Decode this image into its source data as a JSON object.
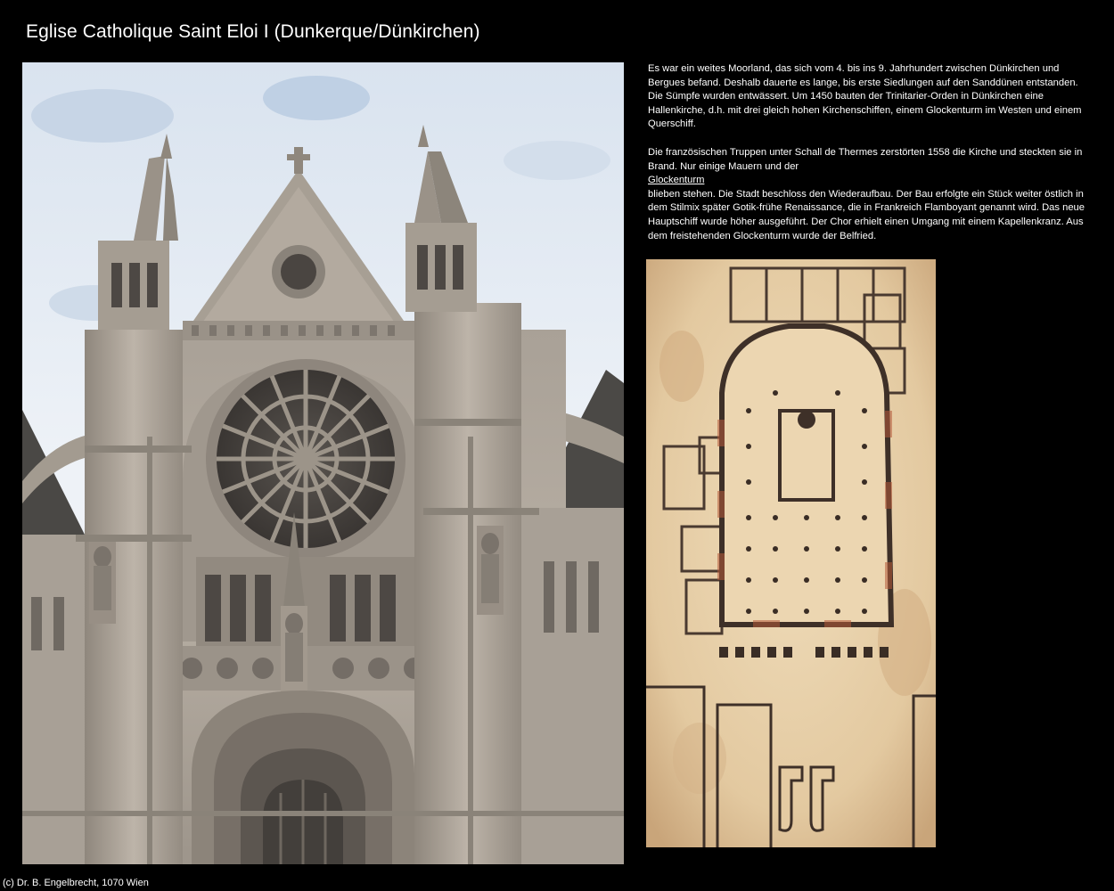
{
  "page": {
    "title": "Eglise Catholique Saint Eloi I (Dunkerque/Dünkirchen)",
    "copyright": "(c) Dr. B. Engelbrecht, 1070 Wien"
  },
  "description": {
    "paragraph1": "Es war ein weites Moorland, das sich vom 4. bis ins 9. Jahrhundert zwischen Dünkirchen und Bergues befand. Deshalb dauerte es lange, bis erste Siedlungen auf den Sanddünen entstanden. Die Sümpfe wurden entwässert. Um 1450 bauten der Trinitarier-Orden in Dünkirchen eine Hallenkirche, d.h. mit drei gleich hohen Kirchenschiffen, einem Glockenturm im Westen und einem Querschiff.",
    "paragraph2_before_link": "Die französischen Truppen unter Schall de Thermes zerstörten 1558 die Kirche und steckten sie in Brand. Nur einige Mauern und der",
    "link_text": "Glockenturm",
    "paragraph2_after_link": "blieben stehen. Die Stadt beschloss den Wiederaufbau. Der Bau erfolgte ein Stück weiter östlich in dem Stilmix später Gotik-frühe Renaissance, die in Frankreich Flamboyant genannt wird. Das neue Hauptschiff wurde höher ausgeführt. Der Chor erhielt einen Umgang mit einem Kapellenkranz. Aus dem freistehenden Glockenturm wurde der Belfried."
  },
  "colors": {
    "background": "#000000",
    "text": "#ffffff",
    "stone": "#b9b0a5",
    "sky": "#e6ecf4",
    "parchment": "#e4cda6"
  }
}
